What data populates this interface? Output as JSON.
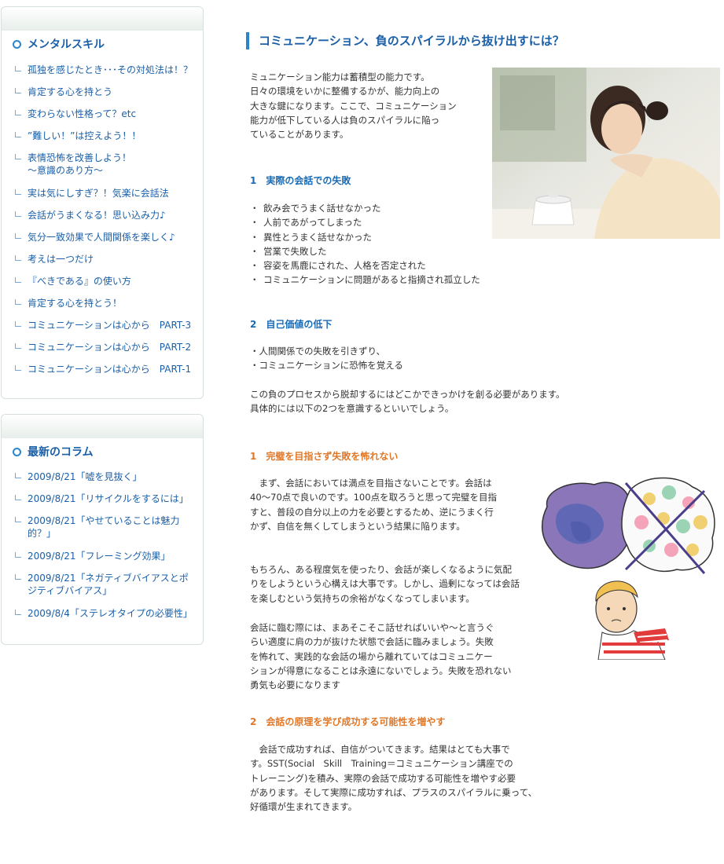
{
  "sidebar": {
    "mental": {
      "title": "メンタルスキル",
      "items": [
        "孤独を感じたとき･･･その対処法は！？",
        "肯定する心を持とう",
        "変わらない性格って？etc",
        "”難しい！”は控えよう！！",
        "表情恐怖を改善しよう！\n～意識のあり方～",
        "実は気にしすぎ？！気楽に会話法",
        "会話がうまくなる！思い込み力♪",
        "気分一致効果で人間関係を楽しく♪",
        "考えは一つだけ",
        "『べきである』の使い方",
        "肯定する心を持とう！",
        "コミュニケーションは心から　PART-3",
        "コミュニケーションは心から　PART-2",
        "コミュニケーションは心から　PART-1"
      ]
    },
    "columns": {
      "title": "最新のコラム",
      "items": [
        "2009/8/21「嘘を見抜く」",
        "2009/8/21「リサイクルをするには」",
        "2009/8/21「やせていることは魅力的？」",
        "2009/8/21「フレーミング効果」",
        "2009/8/21「ネガティブバイアスとポジティブバイアス」",
        "2009/8/4「ステレオタイプの必要性」"
      ]
    }
  },
  "main": {
    "title": "コミュニケーション、負のスパイラルから抜け出すには？",
    "intro": "ミュニケーション能力は蓄積型の能力です。\n日々の環境をいかに整備するかが、能力向上の\n大きな鍵になります。ここで、コミュニケーション\n能力が低下している人は負のスパイラルに陥っ\nていることがあります。",
    "section1": {
      "heading": "1　実際の会話での失敗",
      "bullet_mark": "・",
      "bullets": [
        "飲み会でうまく話せなかった",
        "人前であがってしまった",
        "異性とうまく話せなかった",
        "営業で失敗した",
        "容姿を馬鹿にされた、人格を否定された",
        "コミュニケーションに問題があると指摘され孤立した"
      ]
    },
    "section2": {
      "heading": "2　自己価値の低下",
      "lines": "・人間関係での失敗を引きずり、\n・コミュニケーションに恐怖を覚える",
      "para": "この負のプロセスから脱却するにはどこかできっかけを創る必要があります。\n具体的には以下の2つを意識するといいでしょう。"
    },
    "tip1": {
      "heading": "1　完璧を目指さず失敗を怖れない",
      "para1": "　まず、会話においては満点を目指さないことです。会話は\n40～70点で良いのです。100点を取ろうと思って完璧を目指\nすと、普段の自分以上の力を必要とするため、逆にうまく行\nかず、自信を無くしてしまうという結果に陥ります。",
      "para2": "もちろん、ある程度気を使ったり、会話が楽しくなるように気配\nりをしようという心構えは大事です。しかし、過剰になっては会話\nを楽しむという気持ちの余裕がなくなってしまいます。",
      "para3": "会話に臨む際には、まあそこそこ話せればいいや～と言うぐ\nらい適度に肩の力が抜けた状態で会話に臨みましょう。失敗\nを怖れて、実践的な会話の場から離れていてはコミュニケー\nションが得意になることは永遠にないでしょう。失敗を恐れない\n勇気も必要になります"
    },
    "tip2": {
      "heading": "2　会話の原理を学び成功する可能性を増やす",
      "para": "　会話で成功すれば、自信がついてきます。結果はとても大事で\nす。SST(Social　Skill　Training＝コミュニケーション講座での\nトレーニング)を積み、実際の会話で成功する可能性を増やす必要\nがあります。そして実際に成功すれば、プラスのスパイラルに乗って、\n好循環が生まれてきます。"
    }
  },
  "colors": {
    "link": "#1a5fa8",
    "accent": "#2a86cc",
    "orange": "#e0782a"
  }
}
